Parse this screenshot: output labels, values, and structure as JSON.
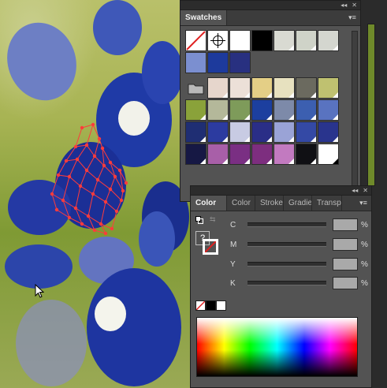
{
  "swatches_panel": {
    "title": "Swatches",
    "collapse_glyph": "◂◂",
    "close_glyph": "✕",
    "menu_glyph": "▾≡",
    "swatches": [
      {
        "color": "#ffffff",
        "kind": "none"
      },
      {
        "color": "#ffffff",
        "kind": "registration"
      },
      {
        "color": "#ffffff",
        "kind": "plain"
      },
      {
        "color": "#000000",
        "kind": "plain"
      },
      {
        "color": "#d9dad2",
        "kind": "global"
      },
      {
        "color": "#cfd3c8",
        "kind": "global"
      },
      {
        "color": "#d4d6cf",
        "kind": "global"
      },
      {
        "color": "#7b8fd0",
        "kind": "plain"
      },
      {
        "color": "#1d3a9c",
        "kind": "plain"
      },
      {
        "color": "#283080",
        "kind": "plain"
      },
      {
        "color": "#b9b9b9",
        "kind": "folder"
      },
      {
        "color": "#e6d6cc",
        "kind": "global"
      },
      {
        "color": "#ece0d8",
        "kind": "global"
      },
      {
        "color": "#e4cf86",
        "kind": "global"
      },
      {
        "color": "#e7e1bf",
        "kind": "global"
      },
      {
        "color": "#6b6a5f",
        "kind": "global"
      },
      {
        "color": "#bfc170",
        "kind": "global"
      },
      {
        "color": "#8aa23a",
        "kind": "global"
      },
      {
        "color": "#b4b89a",
        "kind": "global"
      },
      {
        "color": "#7e9b5a",
        "kind": "global"
      },
      {
        "color": "#1c3f9f",
        "kind": "global"
      },
      {
        "color": "#7d8aa9",
        "kind": "global"
      },
      {
        "color": "#3c5fb0",
        "kind": "global"
      },
      {
        "color": "#5973c0",
        "kind": "global"
      },
      {
        "color": "#1f2e73",
        "kind": "global"
      },
      {
        "color": "#2c3ba0",
        "kind": "global"
      },
      {
        "color": "#c8cbe3",
        "kind": "global"
      },
      {
        "color": "#2a2e87",
        "kind": "global"
      },
      {
        "color": "#9aa3d6",
        "kind": "global"
      },
      {
        "color": "#3449a5",
        "kind": "global"
      },
      {
        "color": "#29348d",
        "kind": "global"
      },
      {
        "color": "#161844",
        "kind": "global"
      },
      {
        "color": "#a85fa8",
        "kind": "global"
      },
      {
        "color": "#7a2f83",
        "kind": "global"
      },
      {
        "color": "#7d2e7f",
        "kind": "global"
      },
      {
        "color": "#c27ac0",
        "kind": "global"
      },
      {
        "color": "#101014",
        "kind": "global"
      },
      {
        "color": "#ffffff",
        "kind": "global-dark"
      }
    ]
  },
  "color_panel": {
    "tabs": [
      {
        "label": "Color",
        "active": true
      },
      {
        "label": "Color",
        "active": false
      },
      {
        "label": "Stroke",
        "active": false
      },
      {
        "label": "Gradie",
        "active": false
      },
      {
        "label": "Transp",
        "active": false
      }
    ],
    "collapse_glyph": "◂◂",
    "close_glyph": "✕",
    "menu_glyph": "▾≡",
    "sliders": [
      {
        "label": "C",
        "unit": "%"
      },
      {
        "label": "M",
        "unit": "%"
      },
      {
        "label": "Y",
        "unit": "%"
      },
      {
        "label": "K",
        "unit": "%"
      }
    ],
    "fill_stroke_hint": "?"
  },
  "canvas": {
    "selection_color": "#ff3b3b",
    "pointer_glyph": "➤"
  }
}
